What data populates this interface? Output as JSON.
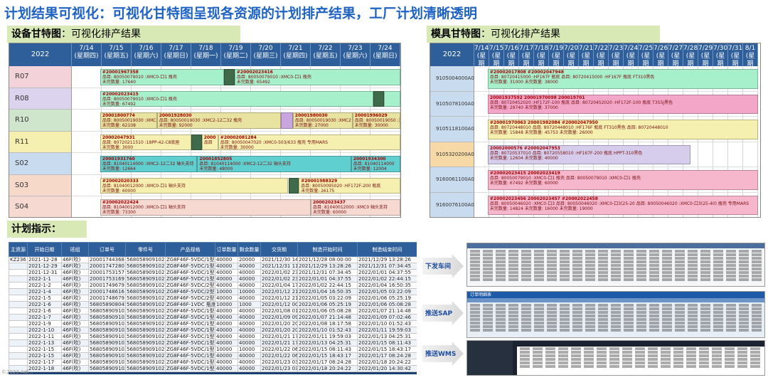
{
  "title": "计划结果可视化：可视化甘特图呈现各资源的计划排产结果，工厂计划清晰透明",
  "equipment_gantt": {
    "label_bold": "设备甘特图",
    "label_rest": "：可视化排产结果",
    "year": "2022",
    "dates": [
      {
        "d": "7/14",
        "w": "(星期四)"
      },
      {
        "d": "7/15",
        "w": "(星期五)"
      },
      {
        "d": "7/16",
        "w": "(星期六)"
      },
      {
        "d": "7/17",
        "w": "(星期日)"
      },
      {
        "d": "7/18",
        "w": "(星期一)"
      },
      {
        "d": "7/19",
        "w": "(星期二)"
      },
      {
        "d": "7/20",
        "w": "(星期三)"
      },
      {
        "d": "7/21",
        "w": "(星期四)"
      },
      {
        "d": "7/22",
        "w": "(星期五)"
      },
      {
        "d": "7/23",
        "w": "(星期六)"
      },
      {
        "d": "7/24",
        "w": "(星期日)"
      }
    ],
    "rows": [
      {
        "name": "R07",
        "color": "#f3d3d9"
      },
      {
        "name": "R08",
        "color": "#dcd3ee"
      },
      {
        "name": "R10",
        "color": "#cfe6cd"
      },
      {
        "name": "R11",
        "color": "#f6f0b0"
      },
      {
        "name": "S02",
        "color": "#c9dbee"
      },
      {
        "name": "S03",
        "color": "#f6d9c9"
      },
      {
        "name": "S04",
        "color": "#f6d9d0"
      }
    ],
    "bars": [
      {
        "row": 0,
        "start": 0.95,
        "end": 5.1,
        "color": "#a6f0cc",
        "l1": "#20001967358",
        "l2": "品目: 80050079010 :XMC0-口1 瓶壳",
        "l3": "未完数量: 17640"
      },
      {
        "row": 0,
        "start": 5.1,
        "end": 5.45,
        "color": "#3f6b4a",
        "l1": "",
        "l2": "",
        "l3": ""
      },
      {
        "row": 0,
        "start": 5.45,
        "end": 11.0,
        "color": "#a6f0cc",
        "l1": "#20002023416",
        "l2": "品目: 80050079010 :XMC0-口1 瓶壳",
        "l3": "未完数量: 65492"
      },
      {
        "row": 1,
        "start": 0.95,
        "end": 10.1,
        "color": "#a6f0cc",
        "l1": "#20002023415",
        "l2": "品目: 80050079010 :XMC0-口1 瓶壳",
        "l3": "未完数量: 67492"
      },
      {
        "row": 1,
        "start": 10.1,
        "end": 10.45,
        "color": "#3f6b4a",
        "l1": "",
        "l2": "",
        "l3": ""
      },
      {
        "row": 1,
        "start": 10.45,
        "end": 11.0,
        "color": "#a6f0cc",
        "l1": "",
        "l2": "",
        "l3": ""
      },
      {
        "row": 2,
        "start": 0.95,
        "end": 2.85,
        "color": "#e8e3a0",
        "l1": "20001800774",
        "l2": "品目: 80050019030 :XMC2-12二32 瓶壳",
        "l3": "未完数量: 62108"
      },
      {
        "row": 2,
        "start": 2.85,
        "end": 7.0,
        "color": "#e8e3a0",
        "l1": "20001928030",
        "l2": "品目: 80050019030 :XMC2-12二32 瓶壳",
        "l3": "未完数量: 92000"
      },
      {
        "row": 2,
        "start": 7.0,
        "end": 7.4,
        "color": "#c9a6e0",
        "l1": "",
        "l2": "",
        "l3": ""
      },
      {
        "row": 2,
        "start": 7.4,
        "end": 9.4,
        "color": "#e8e3a0",
        "l1": "20001980030",
        "l2": "品目: 80050019030 :XMC2",
        "l3": "未完数量: 27000"
      },
      {
        "row": 2,
        "start": 9.4,
        "end": 11.0,
        "color": "#e8e3a0",
        "l1": "20001996029",
        "l2": "品目: 80050019050 :XMC2",
        "l3": "未完数量: 30000"
      },
      {
        "row": 3,
        "start": 0.95,
        "end": 4.0,
        "color": "#f6f0b0",
        "l1": "20002047931",
        "l2": "品目: 80720211510 :18PP-42-C8底座",
        "l3": "未完数量: 3000"
      },
      {
        "row": 3,
        "start": 4.0,
        "end": 4.35,
        "color": "#3f6b4a",
        "l1": "",
        "l2": "",
        "l3": ""
      },
      {
        "row": 3,
        "start": 4.35,
        "end": 4.9,
        "color": "#f6f0b0",
        "l1": "2000",
        "l2": "品目",
        "l3": ""
      },
      {
        "row": 3,
        "start": 4.9,
        "end": 11.0,
        "color": "#f6f0b0",
        "l1": "#20002081284",
        "l2": "品目: 80050047020 :XMC0-503/633 瓶壳 专用MARS",
        "l3": "未完数量: 30000"
      },
      {
        "row": 4,
        "start": 0.95,
        "end": 4.2,
        "color": "#5fcfcf",
        "l1": "20001931760",
        "l2": "品目: 81040114000 :XMC2-12二32 轴头支持",
        "l3": "未完数量: 12664"
      },
      {
        "row": 4,
        "start": 4.2,
        "end": 9.35,
        "color": "#5fcfcf",
        "l1": "20001852805",
        "l2": "品目: 81040114000 :XMC2-12二32 轴头支持",
        "l3": "未完数量: 48000"
      },
      {
        "row": 4,
        "start": 9.35,
        "end": 11.0,
        "color": "#5fcfcf",
        "l1": "20001934300",
        "l2": "品目: 81040114000",
        "l3": "未完数量: 12004"
      },
      {
        "row": 5,
        "start": 0.95,
        "end": 7.25,
        "color": "#f6f0b0",
        "l1": "#20002020333",
        "l2": "品目: 81040012000 :XMC0-口1 轴头支持",
        "l3": "未完数量: 60000"
      },
      {
        "row": 5,
        "start": 7.25,
        "end": 7.6,
        "color": "#3f6b4a",
        "l1": "",
        "l2": "",
        "l3": ""
      },
      {
        "row": 5,
        "start": 7.6,
        "end": 11.0,
        "color": "#f6f0b0",
        "l1": "#20001988329",
        "l2": "品目: 80050095020 :HF172F-200 瓶底",
        "l3": "未完数量: 26175"
      },
      {
        "row": 6,
        "start": 0.95,
        "end": 8.0,
        "color": "#f6d9d0",
        "l1": "#20002022424",
        "l2": "品目: 81040012000 :XMC0-口1 轴头支持",
        "l3": "未完数量: 73300"
      },
      {
        "row": 6,
        "start": 8.0,
        "end": 11.0,
        "color": "#f6d9d0",
        "l1": "20002023437",
        "l2": "品目: 81040012000 :XMC0 轴头支持",
        "l3": "未完数量: 60000"
      }
    ]
  },
  "mold_gantt": {
    "label_bold": "模具甘特图",
    "label_rest": "：可视化排产结果",
    "year": "2022",
    "dates": [
      {
        "d": "7/14",
        "w": "(星期四)"
      },
      {
        "d": "7/15",
        "w": "(星期五)"
      },
      {
        "d": "7/16",
        "w": "(星期六)"
      },
      {
        "d": "7/17",
        "w": "(星期日)"
      },
      {
        "d": "7/18",
        "w": "(星期一)"
      },
      {
        "d": "7/19",
        "w": "(星期二)"
      },
      {
        "d": "7/20",
        "w": "(星期三)"
      },
      {
        "d": "7/21",
        "w": "(星期四)"
      },
      {
        "d": "7/22",
        "w": "(星期五)"
      },
      {
        "d": "7/23",
        "w": "(星期六)"
      },
      {
        "d": "7/24",
        "w": "(星期日)"
      },
      {
        "d": "7/25",
        "w": "(星期一)"
      },
      {
        "d": "7/26",
        "w": "(星期二)"
      },
      {
        "d": "7/27",
        "w": "(星期三)"
      },
      {
        "d": "7/28",
        "w": "(星期四)"
      },
      {
        "d": "7/29",
        "w": "(星期五)"
      },
      {
        "d": "7/30",
        "w": "(星期六)"
      },
      {
        "d": "7/31",
        "w": "(星期日)"
      },
      {
        "d": "8/1",
        "w": "(星期一)"
      }
    ],
    "rows": [
      {
        "name": "9105004000A0",
        "color": "#c9dbee"
      },
      {
        "name": "9105078100A0",
        "color": "#c9dbee"
      },
      {
        "name": "9105118100A0",
        "color": "#c9dbee"
      },
      {
        "name": "9105320200A0",
        "color": "#f6d9a6"
      },
      {
        "name": "9160061100A0",
        "color": "#c9dbee"
      },
      {
        "name": "9160076100A0",
        "color": "#c9dbee"
      }
    ],
    "bars": [
      {
        "row": 0,
        "start": 0.9,
        "end": 19,
        "color": "#a6f0cc",
        "l1": "#20002017808             #20002047948",
        "l2": "品目: 80720415000 :HF167F 瓶底   品目: 80720415000 :HF167F 瓶底 FT310黑色",
        "l3": "未完数量: 31000                    未完数量: 38000"
      },
      {
        "row": 1,
        "start": 0.9,
        "end": 19,
        "color": "#f4a6c9",
        "l1": "        20001937592                        20001970098                 200019701",
        "l2": "        品目: 80720452020 :HF172F-100 瓶底   品目: 80720452020 :HF172F-100 瓶底 T355J黑色",
        "l3": "        未完数量: 29740                    未完数量: 37000"
      },
      {
        "row": 2,
        "start": 0.9,
        "end": 19,
        "color": "#f6f0b0",
        "l1": "#20001970063          20001982084                  #20002047950",
        "l2": "品目: 80720448010 品目: 80720448010 :HF176F 瓶底 FT310黑色 品目: 80720448010",
        "l3": "未完数量: 15848      未完数量: 45753              未完数量: 26000"
      },
      {
        "row": 3,
        "start": 0.9,
        "end": 14.5,
        "color": "#d5cdeb",
        "l1": "20002000576    #20002047953",
        "l2": "品目: 80720537010 品目: 80720558010 :HF167F-200 瓶底 HPPT-310黑色",
        "l3": "未完数量: 12604  未完数量: 40000"
      },
      {
        "row": 4,
        "start": 0.9,
        "end": 19,
        "color": "#f6b6cc",
        "l1": "#20002023415                          20002023419",
        "l2": "品目: 80050079010 :XMC0-口1 瓶壳        品目: 80050079010 :XMC0-口1 瓶壳",
        "l3": "未完数量: 67492                        未完数量: 60000"
      },
      {
        "row": 5,
        "start": 0.9,
        "end": 19,
        "color": "#f6b6cc",
        "l1": "#20002023456        20002023457          #20002022458",
        "l2": "品目: 80050046020 :XMC0-口3 品目: 80050046020 :XMC0-口3(25-20 品目: 80050046020 :XMC0-口3(25-40) 瓶壳 专用MARS",
        "l3": "未完数量: 14824     未完数量: 16000       未完数量: 19000"
      }
    ]
  },
  "instruction": {
    "label": "计划指示：",
    "columns": [
      "主资源",
      "开始日期",
      "班组",
      "订单号",
      "零件号",
      "产品规格",
      "订单数量",
      "剩余数量",
      "交货期",
      "制造开始时间",
      "制造结束时间"
    ],
    "rows": [
      [
        "KZ236",
        "2021-12-28",
        "46F(吹)",
        "20001744368",
        "568058909102",
        "ZG8F46F-5VDC/1型 F",
        "40000",
        "20000",
        "2021/12/30 14:",
        "2021/12/28 08:00:00",
        "2021/12/29 13:28:26"
      ],
      [
        "",
        "2021-12-29",
        "46F(吹)",
        "20001747280",
        "568058909102",
        "ZG8F46F-5VDC/1型 F",
        "40000",
        "40000",
        "2021/12/31 11:",
        "2021/12/29 13:28:26",
        "2021/12/31 07:34:45"
      ],
      [
        "",
        "2021-12-31",
        "46F(吹)",
        "20001753157",
        "568058909102",
        "ZG8F46F-5VDC/1型",
        "40000",
        "40000",
        "2022/01/02 23:",
        "2021/12/31 07:34:45",
        "2022/01/01 04:37:55"
      ],
      [
        "",
        "2022-1-1",
        "46F(吹)",
        "20001753169",
        "568058909102",
        "ZG8F46F-5VDC/1型",
        "40000",
        "40000",
        "2022/01/02 23:",
        "2022/01/01 04:37:55",
        "2022/01/02 22:44:15"
      ],
      [
        "",
        "2022-1-2",
        "46F(吹)",
        "20001749679",
        "568058909102",
        "ZG8F46F-5VDC/2型",
        "40000",
        "40000",
        "2022/01/04 17:",
        "2022/01/02 22:44:15",
        "2022/01/04 16:50:35"
      ],
      [
        "",
        "2022-1-4",
        "46F(吹)",
        "20001748616",
        "568058909102",
        "ZG8F46F-5VDC/2型 F",
        "10000",
        "10000",
        "2022/01/12 21:",
        "2022/01/04 16:50:35",
        "2022/01/05 03:22:09"
      ],
      [
        "",
        "2022-1-5",
        "46F(吹)",
        "20001748679",
        "568058909102",
        "ZG8F46F-5VDC/2型 F",
        "40000",
        "40000",
        "2022/01/12 21:",
        "2022/01/05 03:22:09",
        "2022/01/06 05:25:19"
      ],
      [
        "",
        "2022-1-6",
        "46F(吹)",
        "568058908045-1",
        "568058909102",
        "ZG8F46F-1VDC 瓶底",
        "10000",
        "1000",
        "2022/01/12 00:",
        "2022/01/06 05:25:19",
        "2022/01/06 05:08:28"
      ],
      [
        "",
        "2022-1-6",
        "46F(吹)",
        "568058909102-9",
        "568058909102",
        "ZG8F46F-5VDC/1型",
        "40000",
        "40000",
        "2022/01/08 01:",
        "2022/01/06 05:08:28",
        "2022/01/07 21:14:48"
      ],
      [
        "",
        "2022-1-7",
        "46F(吹)",
        "568058909102-9",
        "568058909102",
        "ZG8F46F-5VDC/1型",
        "40000",
        "40000",
        "2022/01/09 09:",
        "2022/01/07 21:14:48",
        "2022/01/09 07:02:46"
      ],
      [
        "",
        "2022-1-9",
        "46F(吹)",
        "568058909102-19",
        "568058909102",
        "ZG8F46F-5VDC/1型",
        "40000",
        "40000",
        "2022/01/20 20:",
        "2022/01/08 18:17:58",
        "2022/01/10 01:52:43"
      ],
      [
        "",
        "2022-1-10",
        "46F(吹)",
        "568058909102-19",
        "568058909102",
        "ZG8F46F-5VDC/1型",
        "40000",
        "40000",
        "2022/01/20 20:",
        "2022/01/10 01:52:43",
        "2022/01/11 19:59:03"
      ],
      [
        "",
        "2022-1-11",
        "46F(吹)",
        "568058909102-20",
        "568058909102",
        "ZG8F46F-5VDC/1型",
        "40000",
        "40000",
        "2022/01/21 17:",
        "2022/01/11 19:59:03",
        "2022/01/13 04:25:31"
      ],
      [
        "",
        "2022-1-13",
        "46F(吹)",
        "568058909102-20",
        "568058909102",
        "ZG8F46F-5VDC/1型",
        "40000",
        "40000",
        "2022/01/21 17:",
        "2022/01/13 04:25:31",
        "2022/01/15 08:11:43"
      ],
      [
        "",
        "2022-1-15",
        "46F(吹)",
        "568058909102-21",
        "568058909102",
        "ZG8F46F-5VDC/1型",
        "10000",
        "10000",
        "2022/01/22 06:",
        "2022/01/15 08:11:43",
        "2022/01/15 18:43:17"
      ],
      [
        "",
        "2022-1-15",
        "46F(吹)",
        "568058909102-21",
        "568058909102",
        "ZG8F46F-5VDC/1型",
        "40000",
        "40000",
        "2022/01/22 06:",
        "2022/01/15 18:43:17",
        "2022/01/17 08:24:28"
      ],
      [
        "",
        "2022-1-17",
        "46F(吹)",
        "568058909102-22",
        "568058909102",
        "ZG8F46F-5VDC/1型",
        "40000",
        "40000",
        "2022/01/23 03:",
        "2022/01/17 08:24:28",
        "2022/01/18 20:24:22"
      ],
      [
        "",
        "2022-1-18",
        "46F(吹)",
        "568058909102-22",
        "568058909102",
        "ZG8F46F-5VDC/1型",
        "40000",
        "40000",
        "2022/01/23 03:",
        "2022/01/18 20:24:22",
        "2022/01/20 14:30:42"
      ]
    ]
  },
  "pushes": [
    {
      "label": "下发车间"
    },
    {
      "label": "推送SAP"
    },
    {
      "label": "推送WMS"
    }
  ],
  "sap_panel_title": "订单明细表",
  "footer": "©2023 Adl... "
}
